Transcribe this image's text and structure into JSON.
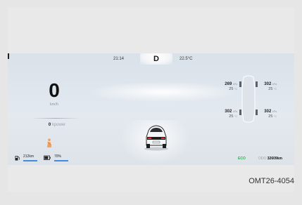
{
  "top_bar": {
    "time": "21:14",
    "gear": "D",
    "outside_temp": "22.5°C"
  },
  "speedometer": {
    "speed": "0",
    "unit": "km/h"
  },
  "power": {
    "value": "0",
    "unit": "kpower"
  },
  "tires": {
    "front_left": {
      "pressure": "269",
      "pressure_unit": "kPa",
      "temp": "25",
      "temp_unit": "°C"
    },
    "front_right": {
      "pressure": "302",
      "pressure_unit": "kPa",
      "temp": "25",
      "temp_unit": "°C"
    },
    "rear_left": {
      "pressure": "302",
      "pressure_unit": "kPa",
      "temp": "25",
      "temp_unit": "°C"
    },
    "rear_right": {
      "pressure": "302",
      "pressure_unit": "kPa",
      "temp": "25",
      "temp_unit": "°C"
    }
  },
  "status_bar": {
    "range": "212km",
    "battery": "70%",
    "drive_mode": "ECO",
    "odo_label": "ODO",
    "odo_value": "32609km"
  },
  "figure_code": "OMT26-4054",
  "colors": {
    "accent_blue": "#3f8be0",
    "eco_green": "#29b34a",
    "driver_icon": "#f0a05a"
  }
}
